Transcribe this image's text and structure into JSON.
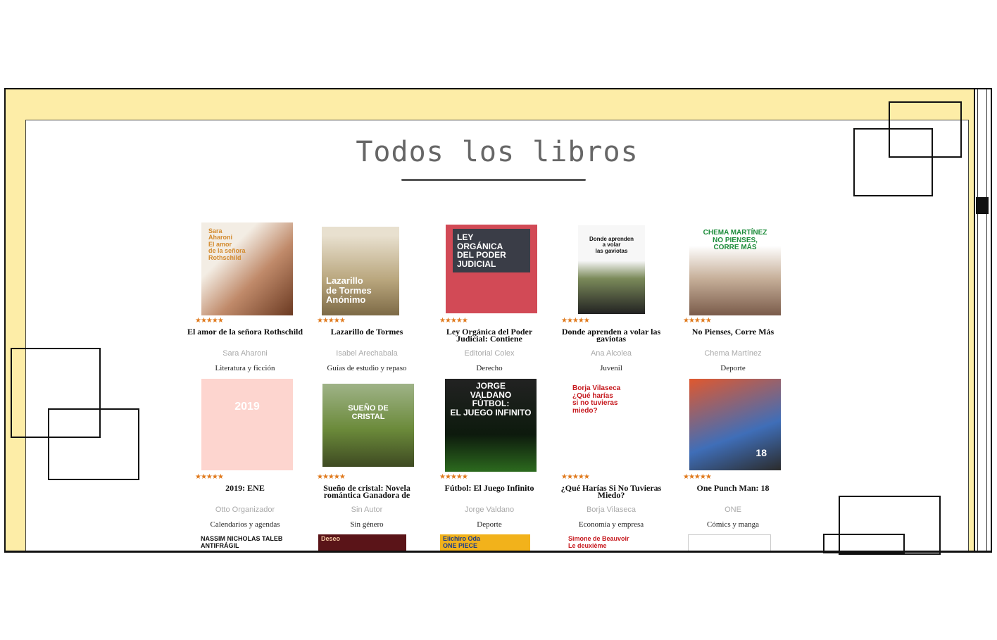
{
  "page": {
    "title": "Todos los libros"
  },
  "books": [
    {
      "title": "El amor de la señora Rothschild",
      "author": "Sara Aharoni",
      "genre": "Literatura y ficción",
      "rating": "★★★★★",
      "cover_text": "Sara\nAharoni\nEl amor\nde la señora\nRothschild"
    },
    {
      "title": "Lazarillo de Tormes",
      "author": "Isabel Arechabala",
      "genre": "Guías de estudio y repaso",
      "rating": "★★★★★",
      "cover_text": "Lazarillo\nde Tormes\nAnónimo"
    },
    {
      "title": "Ley Orgánica del Poder Judicial: Contiene",
      "author": "Editorial Colex",
      "genre": "Derecho",
      "rating": "★★★★★",
      "cover_text": "LEY\nORGÁNICA\nDEL PODER\nJUDICIAL"
    },
    {
      "title": "Donde aprenden a volar las gaviotas",
      "author": "Ana Alcolea",
      "genre": "Juvenil",
      "rating": "★★★★★",
      "cover_text": "Donde aprenden\na volar\nlas gaviotas"
    },
    {
      "title": "No Pienses, Corre Más",
      "author": "Chema Martínez",
      "genre": "Deporte",
      "rating": "★★★★★",
      "cover_text": "CHEMA MARTÍNEZ\nNO PIENSES,\nCORRE MÁS"
    },
    {
      "title": "2019: ENE",
      "author": "Otto Organizador",
      "genre": "Calendarios y agendas",
      "rating": "★★★★★",
      "cover_text": "2019"
    },
    {
      "title": "Sueño de cristal: Novela romántica Ganadora de",
      "author": "Sin Autor",
      "genre": "Sin género",
      "rating": "★★★★★",
      "cover_text": "SUEÑO DE\nCRISTAL"
    },
    {
      "title": "Fútbol: El Juego Infinito",
      "author": "Jorge Valdano",
      "genre": "Deporte",
      "rating": "★★★★★",
      "cover_text": "JORGE\nVALDANO\nFÚTBOL:\nEL JUEGO INFINITO"
    },
    {
      "title": "¿Qué Harías Si No Tuvieras Miedo?",
      "author": "Borja Vilaseca",
      "genre": "Economía y empresa",
      "rating": "★★★★★",
      "cover_text": "Borja Vilaseca\n¿Qué harías\nsi no tuvieras\nmiedo?"
    },
    {
      "title": "One Punch Man: 18",
      "author": "ONE",
      "genre": "Cómics y manga",
      "rating": "★★★★★",
      "cover_text": "18"
    }
  ],
  "partial_covers": [
    {
      "text": "NASSIM NICHOLAS TALEB\nANTIFRÁGIL"
    },
    {
      "text": "Deseo"
    },
    {
      "text": "Eiichiro Oda\nONE PIECE"
    },
    {
      "text": "Simone de Beauvoir\nLe deuxième"
    },
    {
      "text": ""
    }
  ],
  "colors": {
    "frame": "#fdeda7",
    "stars": "#e07a1d",
    "author": "#aaaaaa"
  }
}
